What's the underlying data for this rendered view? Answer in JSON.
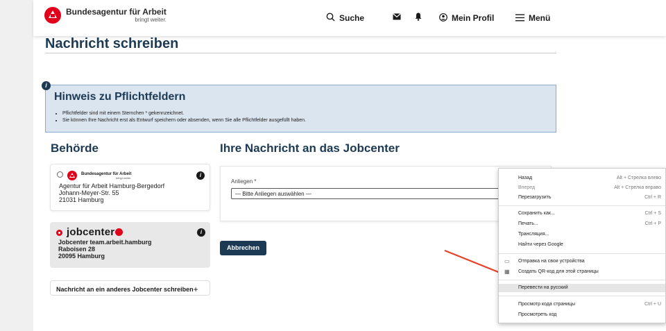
{
  "header": {
    "logo_title": "Bundesagentur für Arbeit",
    "logo_sub": "bringt weiter.",
    "search_label": "Suche",
    "profile_label": "Mein Profil",
    "menu_label": "Menü",
    "icons": [
      "search-icon",
      "mail-icon",
      "bell-icon",
      "user-icon",
      "hamburger-icon"
    ]
  },
  "page_title": "Nachricht schreiben",
  "hinweis": {
    "title": "Hinweis zu Pflichtfeldern",
    "items": [
      "Pflichtfelder sind mit einem Sternchen * gekennzeichnet.",
      "Sie können Ihre Nachricht erst als Entwurf speichern oder absenden, wenn Sie alle Pflichtfelder ausgefüllt haben."
    ]
  },
  "behoerde": {
    "heading": "Behörde",
    "cards": [
      {
        "logo_title": "Bundesagentur für Arbeit",
        "logo_sub": "bringt weiter.",
        "lines": [
          "Agentur für Arbeit Hamburg-Bergedorf",
          "Johann-Meyer-Str. 55",
          "21031 Hamburg"
        ],
        "selected": false
      },
      {
        "logo_text": "jobcenter",
        "lines": [
          "Jobcenter team.arbeit.hamburg",
          "Raboisen 28",
          "20095 Hamburg"
        ],
        "selected": true
      }
    ],
    "other_link": "Nachricht an ein anderes Jobcenter schreiben",
    "other_link_icon": "+"
  },
  "nachricht": {
    "heading": "Ihre Nachricht an das Jobcenter",
    "anliegen_label": "Anliegen *",
    "anliegen_value": "— Bitte Anliegen auswählen —",
    "cancel_label": "Abbrechen"
  },
  "context_menu": {
    "items": [
      {
        "label": "Назад",
        "shortcut": "Alt + Стрелка влево"
      },
      {
        "label": "Вперед",
        "shortcut": "Alt + Стрелка вправо"
      },
      {
        "label": "Перезагрузить",
        "shortcut": "Ctrl + R"
      },
      {
        "label": "Сохранить как...",
        "shortcut": "Ctrl + S"
      },
      {
        "label": "Печать...",
        "shortcut": "Ctrl + P"
      },
      {
        "label": "Трансляция...",
        "shortcut": ""
      },
      {
        "label": "Найти через Google",
        "shortcut": ""
      },
      {
        "label": "Отправка на свои устройства",
        "shortcut": ""
      },
      {
        "label": "Создать QR-код для этой страницы",
        "shortcut": ""
      },
      {
        "label": "Перевести на русский",
        "shortcut": ""
      },
      {
        "label": "Просмотр кода страницы",
        "shortcut": "Ctrl + U"
      },
      {
        "label": "Просмотреть код",
        "shortcut": ""
      }
    ]
  },
  "colors": {
    "brand_red": "#e2001a",
    "navy": "#1c3a54",
    "arrow": "#e8412a"
  }
}
